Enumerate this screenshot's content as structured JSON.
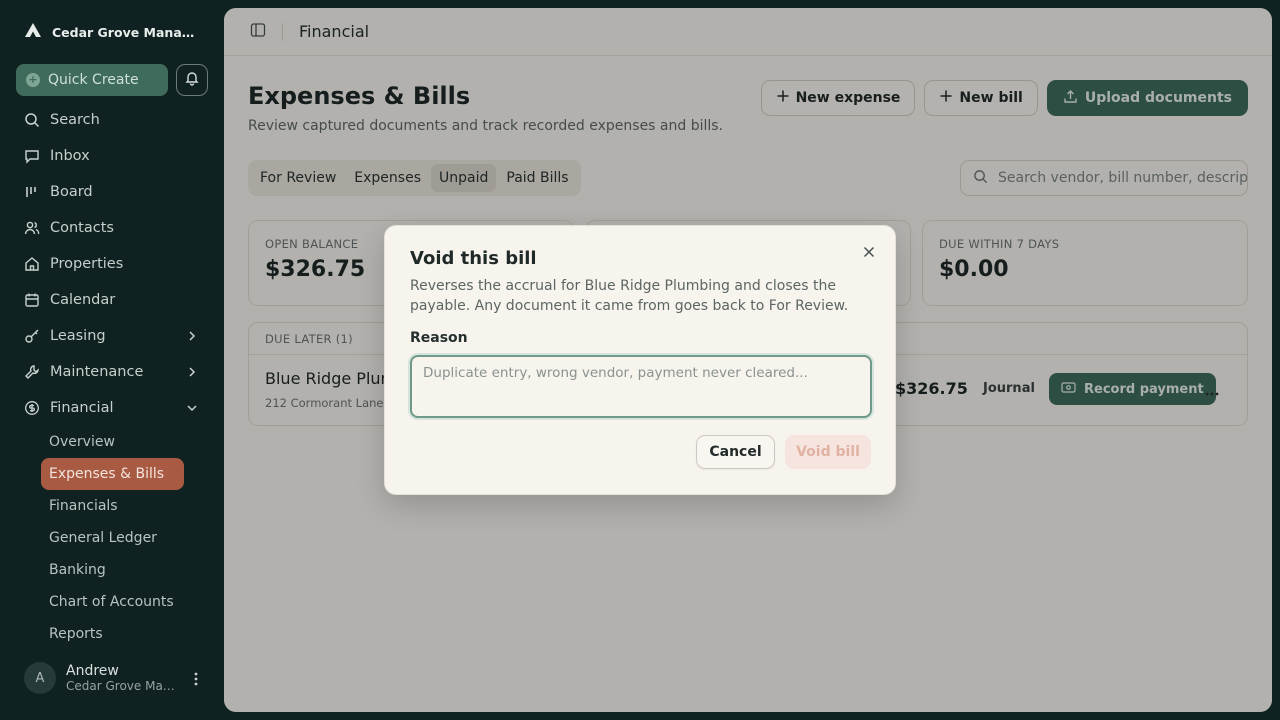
{
  "brand": {
    "name": "Cedar Grove Management",
    "icon": "logo-mountain-icon"
  },
  "sidebar": {
    "quick_create": "Quick Create",
    "nav": [
      {
        "label": "Search",
        "icon": "search-icon"
      },
      {
        "label": "Inbox",
        "icon": "inbox-icon"
      },
      {
        "label": "Board",
        "icon": "board-icon"
      },
      {
        "label": "Contacts",
        "icon": "contacts-icon"
      },
      {
        "label": "Properties",
        "icon": "home-icon"
      },
      {
        "label": "Calendar",
        "icon": "calendar-icon"
      },
      {
        "label": "Leasing",
        "icon": "key-icon"
      },
      {
        "label": "Maintenance",
        "icon": "wrench-icon"
      },
      {
        "label": "Financial",
        "icon": "dollar-icon"
      }
    ],
    "financial_sub": [
      "Overview",
      "Expenses & Bills",
      "Financials",
      "General Ledger",
      "Banking",
      "Chart of Accounts",
      "Reports"
    ],
    "active_sub": "Expenses & Bills"
  },
  "user": {
    "initial": "A",
    "name": "Andrew",
    "org": "Cedar Grove Management"
  },
  "topbar": {
    "breadcrumb": "Financial"
  },
  "page": {
    "title": "Expenses & Bills",
    "subtitle": "Review captured documents and track recorded expenses and bills.",
    "new_expense": "New expense",
    "new_bill": "New bill",
    "upload": "Upload documents",
    "tabs": [
      "For Review",
      "Expenses",
      "Unpaid",
      "Paid Bills"
    ],
    "active_tab": "Unpaid",
    "search_placeholder": "Search vendor, bill number, description..."
  },
  "stats": [
    {
      "label": "OPEN BALANCE",
      "value": "$326.75"
    },
    {
      "label": "",
      "value": ""
    },
    {
      "label": "DUE WITHIN 7 DAYS",
      "value": "$0.00"
    }
  ],
  "list": {
    "header": "DUE LATER (1)",
    "rows": [
      {
        "vendor": "Blue Ridge Plumbing",
        "address": "212 Cormorant Lane",
        "amount": "$326.75",
        "method": "Journal",
        "action": "Record payment"
      }
    ]
  },
  "modal": {
    "title": "Void this bill",
    "description": "Reverses the accrual for Blue Ridge Plumbing and closes the payable. Any document it came from goes back to For Review.",
    "reason_label": "Reason",
    "reason_placeholder": "Duplicate entry, wrong vendor, payment never cleared...",
    "cancel": "Cancel",
    "confirm": "Void bill"
  },
  "colors": {
    "accent": "#3e6b5c",
    "sidebar_bg": "#0f2121",
    "active_nav": "#a95a43",
    "danger_disabled": "#f6e5df"
  }
}
